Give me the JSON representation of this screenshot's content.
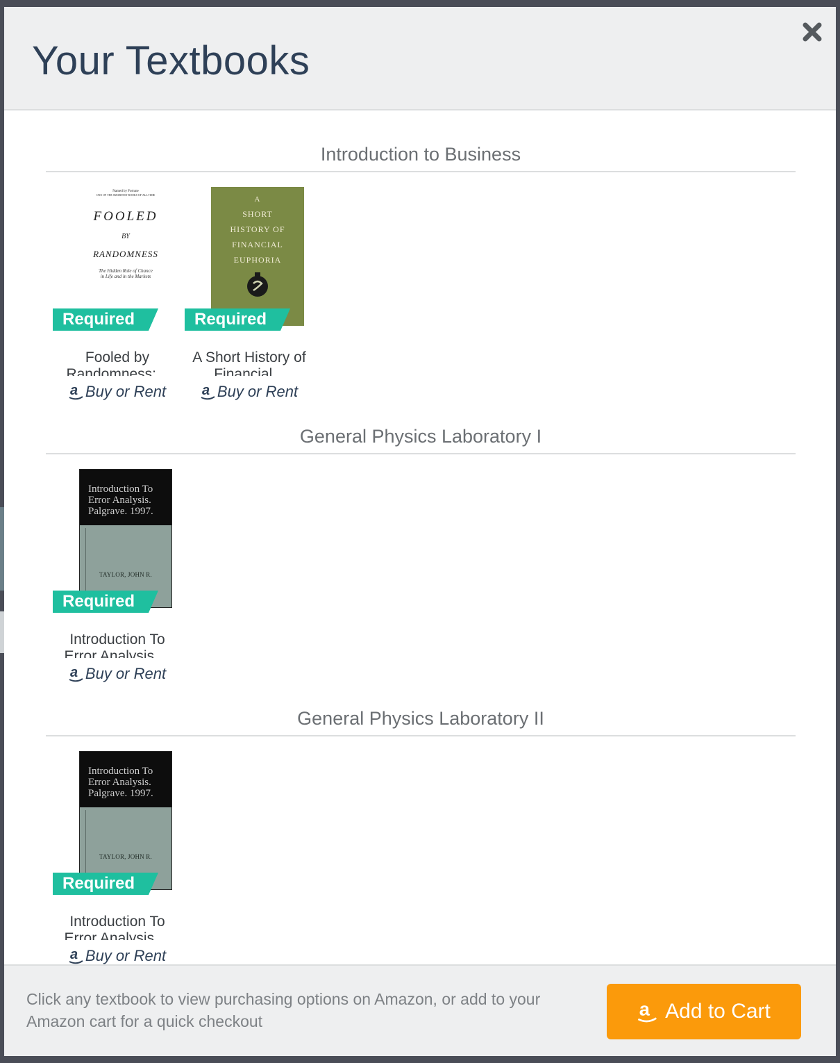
{
  "modal": {
    "title": "Your Textbooks",
    "close_icon": "close-icon"
  },
  "sections": [
    {
      "heading": "Introduction to Business",
      "books": [
        {
          "badge": "Required",
          "title": "Fooled by Randomness:...",
          "buy_label": "Buy or Rent",
          "cover": {
            "type": "white",
            "top_line_1": "Named by Fortune",
            "top_line_2": "ONE OF THE SMARTEST BOOKS OF ALL TIME",
            "title_line_1": "FOOLED",
            "title_line_2": "BY",
            "title_line_3": "RANDOMNESS",
            "subtitle_line_1": "The Hidden Role of Chance",
            "subtitle_line_2": "in Life and in the Markets"
          }
        },
        {
          "badge": "Required",
          "title": "A Short History of Financial...",
          "buy_label": "Buy or Rent",
          "cover": {
            "type": "green",
            "line_1": "A",
            "line_2": "SHORT",
            "line_3": "HISTORY OF",
            "line_4": "FINANCIAL",
            "line_5": "EUPHORIA"
          }
        }
      ]
    },
    {
      "heading": "General Physics Laboratory I",
      "books": [
        {
          "badge": "Required",
          "title": "Introduction To Error Analysis....",
          "buy_label": "Buy or Rent",
          "cover": {
            "type": "dark",
            "line_1": "Introduction To",
            "line_2": "Error Analysis.",
            "line_3": "Palgrave. 1997.",
            "author": "TAYLOR, JOHN R."
          }
        }
      ]
    },
    {
      "heading": "General Physics Laboratory II",
      "books": [
        {
          "badge": "Required",
          "title": "Introduction To Error Analysis....",
          "buy_label": "Buy or Rent",
          "cover": {
            "type": "dark",
            "line_1": "Introduction To",
            "line_2": "Error Analysis.",
            "line_3": "Palgrave. 1997.",
            "author": "TAYLOR, JOHN R."
          }
        }
      ]
    }
  ],
  "footer": {
    "text": "Click any textbook to view purchasing options on Amazon, or add to your Amazon cart for a quick checkout",
    "cart_button": "Add to Cart"
  },
  "colors": {
    "title": "#2e4057",
    "required_badge": "#1fbf9f",
    "cart_button": "#fb9a0b",
    "header_bg": "#eeeff0"
  }
}
